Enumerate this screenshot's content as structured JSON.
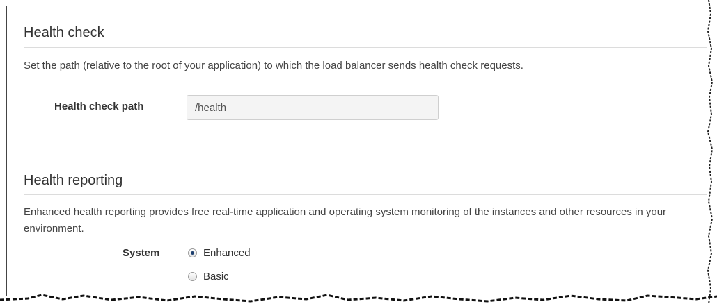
{
  "health_check": {
    "title": "Health check",
    "description": "Set the path (relative to the root of your application) to which the load balancer sends health check requests.",
    "path_label": "Health check path",
    "path_value": "/health"
  },
  "health_reporting": {
    "title": "Health reporting",
    "description": "Enhanced health reporting provides free real-time application and operating system monitoring of the instances and other resources in your environment.",
    "system_label": "System",
    "options": [
      {
        "label": "Enhanced",
        "selected": true
      },
      {
        "label": "Basic",
        "selected": false
      }
    ]
  },
  "colors": {
    "text": "#333333",
    "divider": "#dcdcdc",
    "input_bg": "#f4f4f4",
    "radio_dot": "#1d3f6e"
  }
}
